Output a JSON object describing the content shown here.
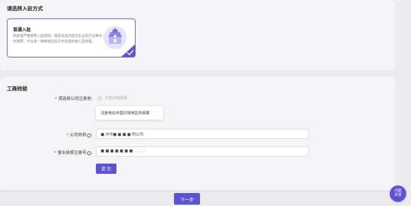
{
  "entry_section": {
    "title": "请选择入驻方式",
    "option": {
      "title": "普通入驻",
      "description": "商家需严格按照入驻规则，填写信息并提交企业及行业等许可资质，平台进一审核通过后才可完成商家入驻流程。",
      "selected": true
    }
  },
  "verify_section": {
    "title": "工商校验",
    "fields": {
      "registration_place": {
        "required_mark": "*",
        "label": "请选择公司注册地",
        "colon": ":",
        "radio_option": "中国大陆商家",
        "tooltip": "注册地在中国大陆地区的商家"
      },
      "company_name": {
        "required_mark": "*",
        "label": "公司名称",
        "help_glyph": "i",
        "colon": ":",
        "value": "■ 州市■ ■ ■ ■ 的公司"
      },
      "license_number": {
        "required_mark": "*",
        "label": "营业执照注册号",
        "help_glyph": "i",
        "colon": ":",
        "value": "■ ■ ■ ■  ■ ■ ■ . . . . :"
      }
    },
    "submit_label": "提 交"
  },
  "footer": {
    "next_label": "下一步"
  },
  "feedback": {
    "line1": "问题",
    "line2": "反馈"
  },
  "colors": {
    "accent": "#5b55d6",
    "required": "#e0463f"
  }
}
